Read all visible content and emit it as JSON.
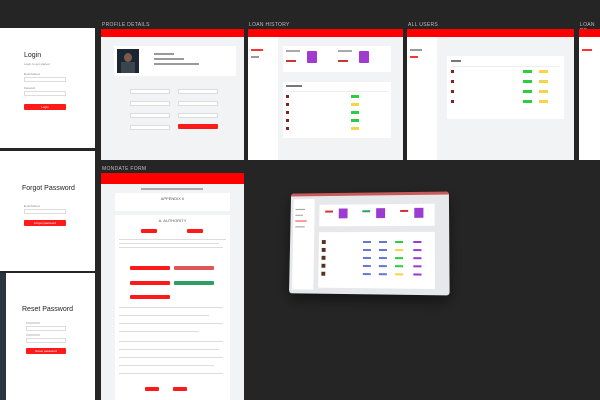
{
  "frames": {
    "profile_details": "PROFILE DETAILS",
    "loan_history": "LOAN HISTORY",
    "all_users": "ALL USERS",
    "loan_re": "LOAN RE",
    "mobile_form": "MONDATE FORM"
  },
  "login": {
    "title": "Login",
    "subtitle": "Login to get started",
    "email_label": "Email Address",
    "password_label": "Password",
    "button": "Login"
  },
  "forgot": {
    "title": "Forgot Password",
    "email_label": "Email Address",
    "button": "Forgot password"
  },
  "reset": {
    "title": "Reset Password",
    "button": "Reset password"
  },
  "form": {
    "heading": "APPENDIX II",
    "section": "A. AUTHORITY"
  },
  "colors": {
    "accent": "#ff0000",
    "green": "#2ecc40",
    "yellow": "#f5d547",
    "purple": "#9b3bd1"
  }
}
